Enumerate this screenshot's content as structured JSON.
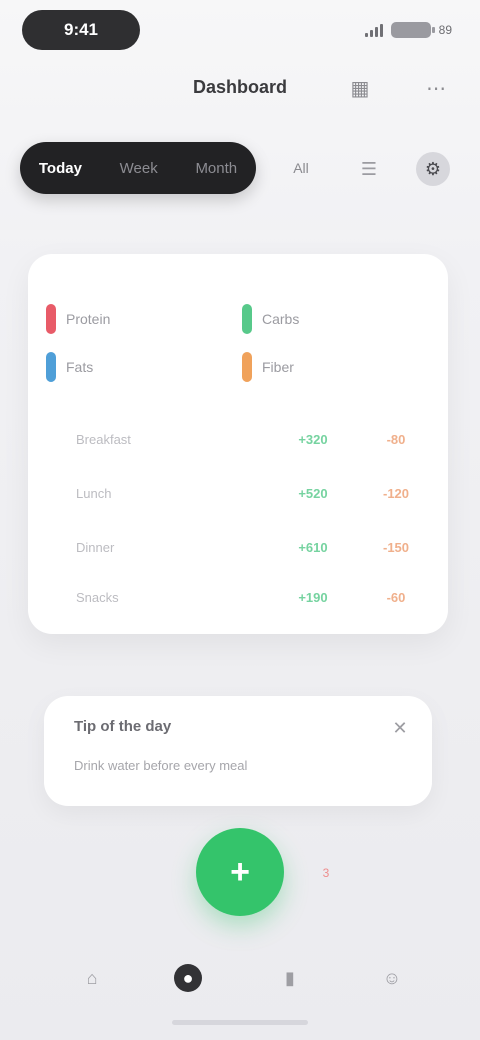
{
  "status_bar": {
    "time": "9:41",
    "battery": "89"
  },
  "header": {
    "title": "Dashboard"
  },
  "toolbar": {
    "segments": [
      "Today",
      "Week",
      "Month"
    ],
    "label": "All"
  },
  "card": {
    "legend": [
      {
        "label": "Protein",
        "color": "#e85b68"
      },
      {
        "label": "Carbs",
        "color": "#57c98a"
      },
      {
        "label": "Fats",
        "color": "#4f9fd8"
      },
      {
        "label": "Fiber",
        "color": "#f0a25b"
      }
    ],
    "rows": [
      {
        "name": "Breakfast",
        "value1": "+320",
        "value2": "-80"
      },
      {
        "name": "Lunch",
        "value1": "+520",
        "value2": "-120"
      },
      {
        "name": "Dinner",
        "value1": "+610",
        "value2": "-150"
      },
      {
        "name": "Snacks",
        "value1": "+190",
        "value2": "-60"
      }
    ]
  },
  "info": {
    "title": "Tip of the day",
    "subtitle": "Drink water before every meal"
  },
  "fab": {
    "label": "+",
    "badge": "3"
  },
  "nav": {
    "items": [
      "Home",
      "Log",
      "Stats",
      "Profile"
    ]
  },
  "colors": {
    "accent": "#34c46b",
    "dark": "#222224"
  }
}
